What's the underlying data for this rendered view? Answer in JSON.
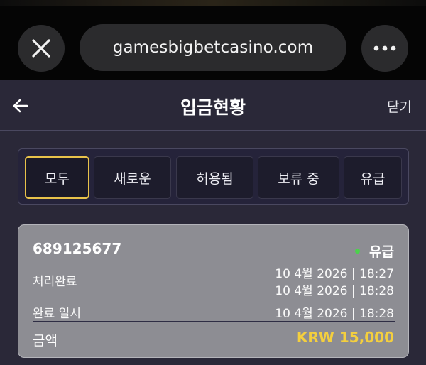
{
  "browser": {
    "url": "gamesbigbetcasino.com",
    "close_icon": "close-icon",
    "more_icon": "more-horizontal-icon"
  },
  "header": {
    "title": "입금현황",
    "close_label": "닫기",
    "back_icon": "arrow-left-icon"
  },
  "tabs": [
    {
      "label": "모두",
      "active": true
    },
    {
      "label": "새로운",
      "active": false
    },
    {
      "label": "허용됨",
      "active": false
    },
    {
      "label": "보류 중",
      "active": false
    },
    {
      "label": "유급",
      "active": false
    }
  ],
  "transaction": {
    "id": "689125677",
    "status": "유급",
    "status_color": "#4cd14c",
    "processed_label": "처리완료",
    "processed_times": [
      "10 4월 2026 | 18:27",
      "10 4월 2026 | 18:28"
    ],
    "completed_label": "완료 일시",
    "completed_time": "10 4월 2026 | 18:28",
    "amount_label": "금액",
    "amount_value": "KRW 15,000",
    "amount_color": "#f4cf3e"
  },
  "colors": {
    "accent": "#e8c24a",
    "background": "#2a2838"
  }
}
